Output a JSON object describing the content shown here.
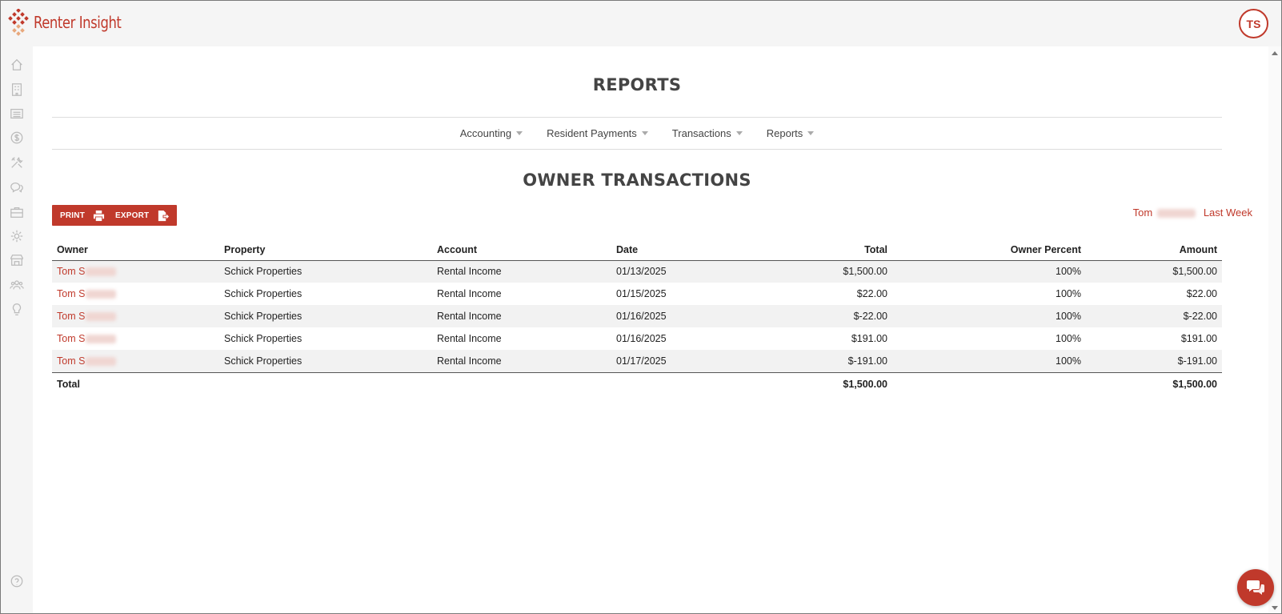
{
  "app": {
    "logo_text": "Renter Insight",
    "user_initials": "TS",
    "brand_color": "#c0392b"
  },
  "sidebar": {
    "icons": [
      "home-icon",
      "building-icon",
      "list-icon",
      "dollar-icon",
      "tools-icon",
      "chat-icon",
      "briefcase-icon",
      "gear-icon",
      "storefront-icon",
      "people-icon",
      "lightbulb-icon",
      "help-icon"
    ]
  },
  "page": {
    "title": "REPORTS",
    "section_title": "OWNER TRANSACTIONS"
  },
  "nav": {
    "items": [
      "Accounting",
      "Resident Payments",
      "Transactions",
      "Reports"
    ]
  },
  "toolbar": {
    "print_label": "PRINT",
    "export_label": "EXPORT"
  },
  "filters": {
    "owner": "Tom",
    "period": "Last Week"
  },
  "table": {
    "headers": {
      "owner": "Owner",
      "property": "Property",
      "account": "Account",
      "date": "Date",
      "total": "Total",
      "owner_percent": "Owner Percent",
      "amount": "Amount"
    },
    "rows": [
      {
        "owner": "Tom S",
        "property": "Schick Properties",
        "account": "Rental Income",
        "date": "01/13/2025",
        "total": "$1,500.00",
        "owner_percent": "100%",
        "amount": "$1,500.00"
      },
      {
        "owner": "Tom S",
        "property": "Schick Properties",
        "account": "Rental Income",
        "date": "01/15/2025",
        "total": "$22.00",
        "owner_percent": "100%",
        "amount": "$22.00"
      },
      {
        "owner": "Tom S",
        "property": "Schick Properties",
        "account": "Rental Income",
        "date": "01/16/2025",
        "total": "$-22.00",
        "owner_percent": "100%",
        "amount": "$-22.00"
      },
      {
        "owner": "Tom S",
        "property": "Schick Properties",
        "account": "Rental Income",
        "date": "01/16/2025",
        "total": "$191.00",
        "owner_percent": "100%",
        "amount": "$191.00"
      },
      {
        "owner": "Tom S",
        "property": "Schick Properties",
        "account": "Rental Income",
        "date": "01/17/2025",
        "total": "$-191.00",
        "owner_percent": "100%",
        "amount": "$-191.00"
      }
    ],
    "footer": {
      "label": "Total",
      "total": "$1,500.00",
      "amount": "$1,500.00"
    }
  }
}
